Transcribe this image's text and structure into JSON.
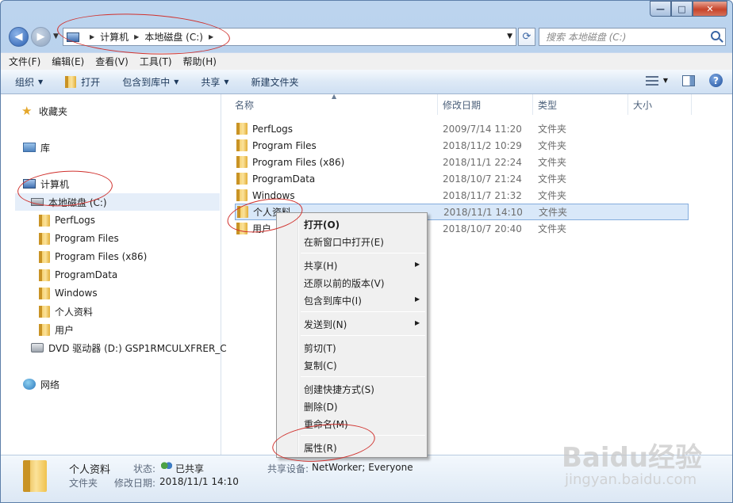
{
  "window": {
    "min_glyph": "—",
    "max_glyph": "□",
    "close_glyph": "✕"
  },
  "nav": {
    "back_glyph": "◀",
    "forward_glyph": "▶"
  },
  "address": {
    "crumbs": [
      "计算机",
      "本地磁盘 (C:)"
    ],
    "search_placeholder": "搜索 本地磁盘 (C:)"
  },
  "menubar": [
    "文件(F)",
    "编辑(E)",
    "查看(V)",
    "工具(T)",
    "帮助(H)"
  ],
  "toolbar": {
    "organize": "组织",
    "open": "打开",
    "include_library": "包含到库中",
    "share": "共享",
    "new_folder": "新建文件夹"
  },
  "nav_pane": {
    "favorites": "收藏夹",
    "libraries": "库",
    "computer": "计算机",
    "local_disk": "本地磁盘 (C:)",
    "folders": [
      "PerfLogs",
      "Program Files",
      "Program Files (x86)",
      "ProgramData",
      "Windows",
      "个人资料",
      "用户"
    ],
    "dvd": "DVD 驱动器 (D:) GSP1RMCULXFRER_C",
    "network": "网络"
  },
  "columns": {
    "name": "名称",
    "date": "修改日期",
    "type": "类型",
    "size": "大小"
  },
  "files": [
    {
      "name": "PerfLogs",
      "date": "2009/7/14 11:20",
      "type": "文件夹"
    },
    {
      "name": "Program Files",
      "date": "2018/11/2 10:29",
      "type": "文件夹"
    },
    {
      "name": "Program Files (x86)",
      "date": "2018/11/1 22:24",
      "type": "文件夹"
    },
    {
      "name": "ProgramData",
      "date": "2018/10/7 21:24",
      "type": "文件夹"
    },
    {
      "name": "Windows",
      "date": "2018/11/7 21:32",
      "type": "文件夹"
    },
    {
      "name": "个人资料",
      "date": "2018/11/1 14:10",
      "type": "文件夹"
    },
    {
      "name": "用户",
      "date": "2018/10/7 20:40",
      "type": "文件夹"
    }
  ],
  "context_menu": {
    "open": "打开(O)",
    "open_new_window": "在新窗口中打开(E)",
    "share": "共享(H)",
    "restore": "还原以前的版本(V)",
    "include_library": "包含到库中(I)",
    "send_to": "发送到(N)",
    "cut": "剪切(T)",
    "copy": "复制(C)",
    "create_shortcut": "创建快捷方式(S)",
    "delete": "删除(D)",
    "rename": "重命名(M)",
    "properties": "属性(R)"
  },
  "details": {
    "name": "个人资料",
    "type": "文件夹",
    "status_label": "状态:",
    "status_value": "已共享",
    "modified_label": "修改日期:",
    "modified_value": "2018/11/1 14:10",
    "shared_with_label": "共享设备:",
    "shared_with_value": "NetWorker; Everyone"
  },
  "watermark": {
    "logo": "Baidu经验",
    "url": "jingyan.baidu.com"
  },
  "colors": {
    "annotation": "#d0312d",
    "selection": "#d9e8f9",
    "toolbar_text": "#1e395b"
  }
}
